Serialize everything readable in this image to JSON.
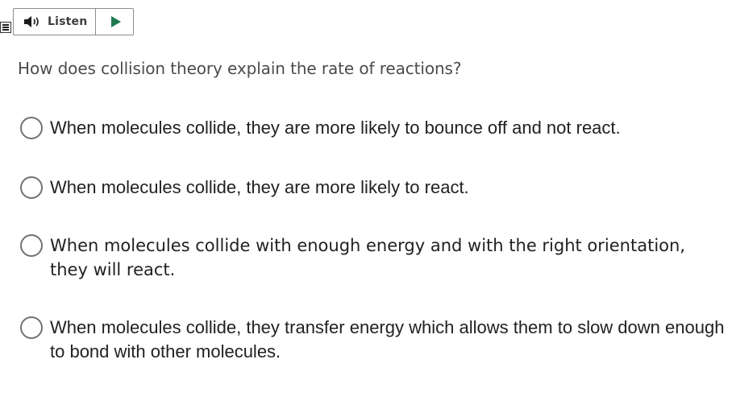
{
  "toolbar": {
    "listen_label": "Listen",
    "speaker_icon": "speaker-icon",
    "play_icon": "play-icon",
    "menu_icon": "menu-icon",
    "play_color": "#1f7a52"
  },
  "question": {
    "text": "How does collision theory explain the rate of reactions?"
  },
  "options": [
    {
      "label": "When molecules collide, they are more likely to bounce off and not react.",
      "selected": false
    },
    {
      "label": "When molecules collide, they are more likely to react.",
      "selected": false
    },
    {
      "label": "When molecules collide with enough energy and with the right orientation, they will react.",
      "selected": false
    },
    {
      "label": "When molecules collide, they transfer energy which allows them to slow down enough to bond with other molecules.",
      "selected": false
    }
  ]
}
